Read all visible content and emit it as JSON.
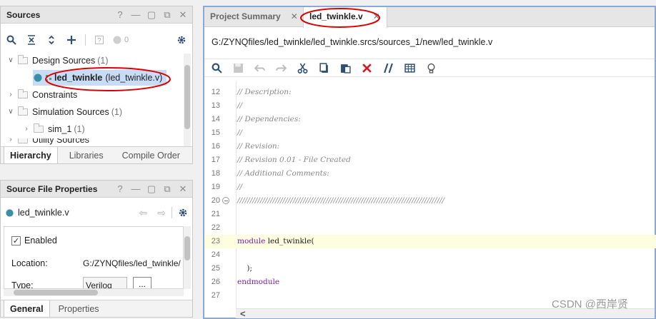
{
  "sources": {
    "title": "Sources",
    "header_icons": [
      "?",
      "—",
      "▢",
      "⧉",
      "✕"
    ],
    "toolbar": {
      "badge_count": "0"
    },
    "tree": [
      {
        "label": "Design Sources",
        "count": "(1)"
      },
      {
        "name": "led_twinkle",
        "detail": "(led_twinkle.v)"
      },
      {
        "label": "Constraints"
      },
      {
        "label": "Simulation Sources",
        "count": "(1)"
      },
      {
        "label": "sim_1",
        "count": "(1)"
      },
      {
        "label": "Utility Sources"
      }
    ],
    "tabs": [
      "Hierarchy",
      "Libraries",
      "Compile Order"
    ]
  },
  "properties": {
    "title": "Source File Properties",
    "header_icons": [
      "?",
      "—",
      "▢",
      "⧉",
      "✕"
    ],
    "file_name": "led_twinkle.v",
    "enabled_label": "Enabled",
    "location_label": "Location:",
    "location_value": "G:/ZYNQfiles/led_twinkle/",
    "type_label": "Type:",
    "type_value": "Verilog",
    "more_button": "...",
    "tabs": [
      "General",
      "Properties"
    ]
  },
  "editor": {
    "tabs": [
      {
        "label": "Project Summary",
        "close": "✕"
      },
      {
        "label": "led_twinkle.v",
        "close": "✕"
      }
    ],
    "path": "G:/ZYNQfiles/led_twinkle/led_twinkle.srcs/sources_1/new/led_twinkle.v",
    "lines": [
      {
        "n": "12",
        "text": "// Description:",
        "kind": "comment"
      },
      {
        "n": "13",
        "text": "//",
        "kind": "comment"
      },
      {
        "n": "14",
        "text": "// Dependencies:",
        "kind": "comment"
      },
      {
        "n": "15",
        "text": "//",
        "kind": "comment"
      },
      {
        "n": "16",
        "text": "// Revision:",
        "kind": "comment"
      },
      {
        "n": "17",
        "text": "// Revision 0.01 - File Created",
        "kind": "comment"
      },
      {
        "n": "18",
        "text": "// Additional Comments:",
        "kind": "comment"
      },
      {
        "n": "19",
        "text": "//",
        "kind": "comment"
      },
      {
        "n": "20",
        "text": "//////////////////////////////////////////////////////////////////////////////////",
        "kind": "comment"
      },
      {
        "n": "21",
        "text": "",
        "kind": "plain"
      },
      {
        "n": "22",
        "text": "",
        "kind": "plain"
      },
      {
        "n": "23",
        "text": "module",
        "rest": " led_twinkle(",
        "kind": "kw"
      },
      {
        "n": "24",
        "text": "",
        "kind": "plain"
      },
      {
        "n": "25",
        "text": "    );",
        "kind": "plain"
      },
      {
        "n": "26",
        "text": "endmodule",
        "kind": "kw"
      },
      {
        "n": "27",
        "text": "",
        "kind": "plain"
      }
    ],
    "scroll_left": "<"
  },
  "watermark": "CSDN @西岸贤",
  "colors": {
    "annotation_red": "#e00000",
    "highlight_line": "#fdfde0",
    "selection": "#c9dcf5"
  }
}
